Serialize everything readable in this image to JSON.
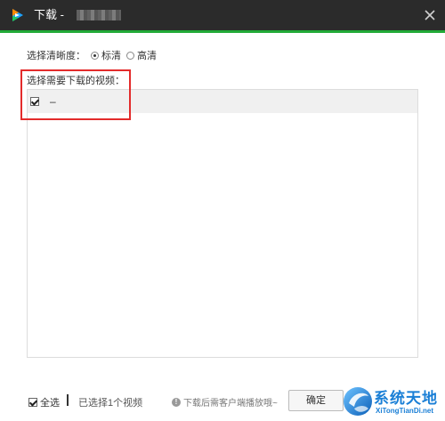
{
  "window": {
    "title": "下载 -",
    "title_suffix_blurred": true
  },
  "quality": {
    "label": "选择清晰度：",
    "options": [
      {
        "label": "标清",
        "selected": true
      },
      {
        "label": "高清",
        "selected": false
      }
    ]
  },
  "list": {
    "label": "选择需要下载的视频：",
    "items": [
      {
        "name": "–",
        "checked": true
      }
    ]
  },
  "footer": {
    "select_all_label": "全选",
    "select_all_checked": true,
    "selected_count_text": "已选择1个视频",
    "hint": "下载后需客户端播放哦~",
    "confirm_label": "确定"
  },
  "watermark": {
    "title": "系统天地",
    "subtitle": "XiTongTianDi.net"
  },
  "colors": {
    "titlebar": "#2b2b2b",
    "accent": "#22ab38",
    "highlight": "#e32b2b",
    "watermark": "#1a7fd6"
  }
}
